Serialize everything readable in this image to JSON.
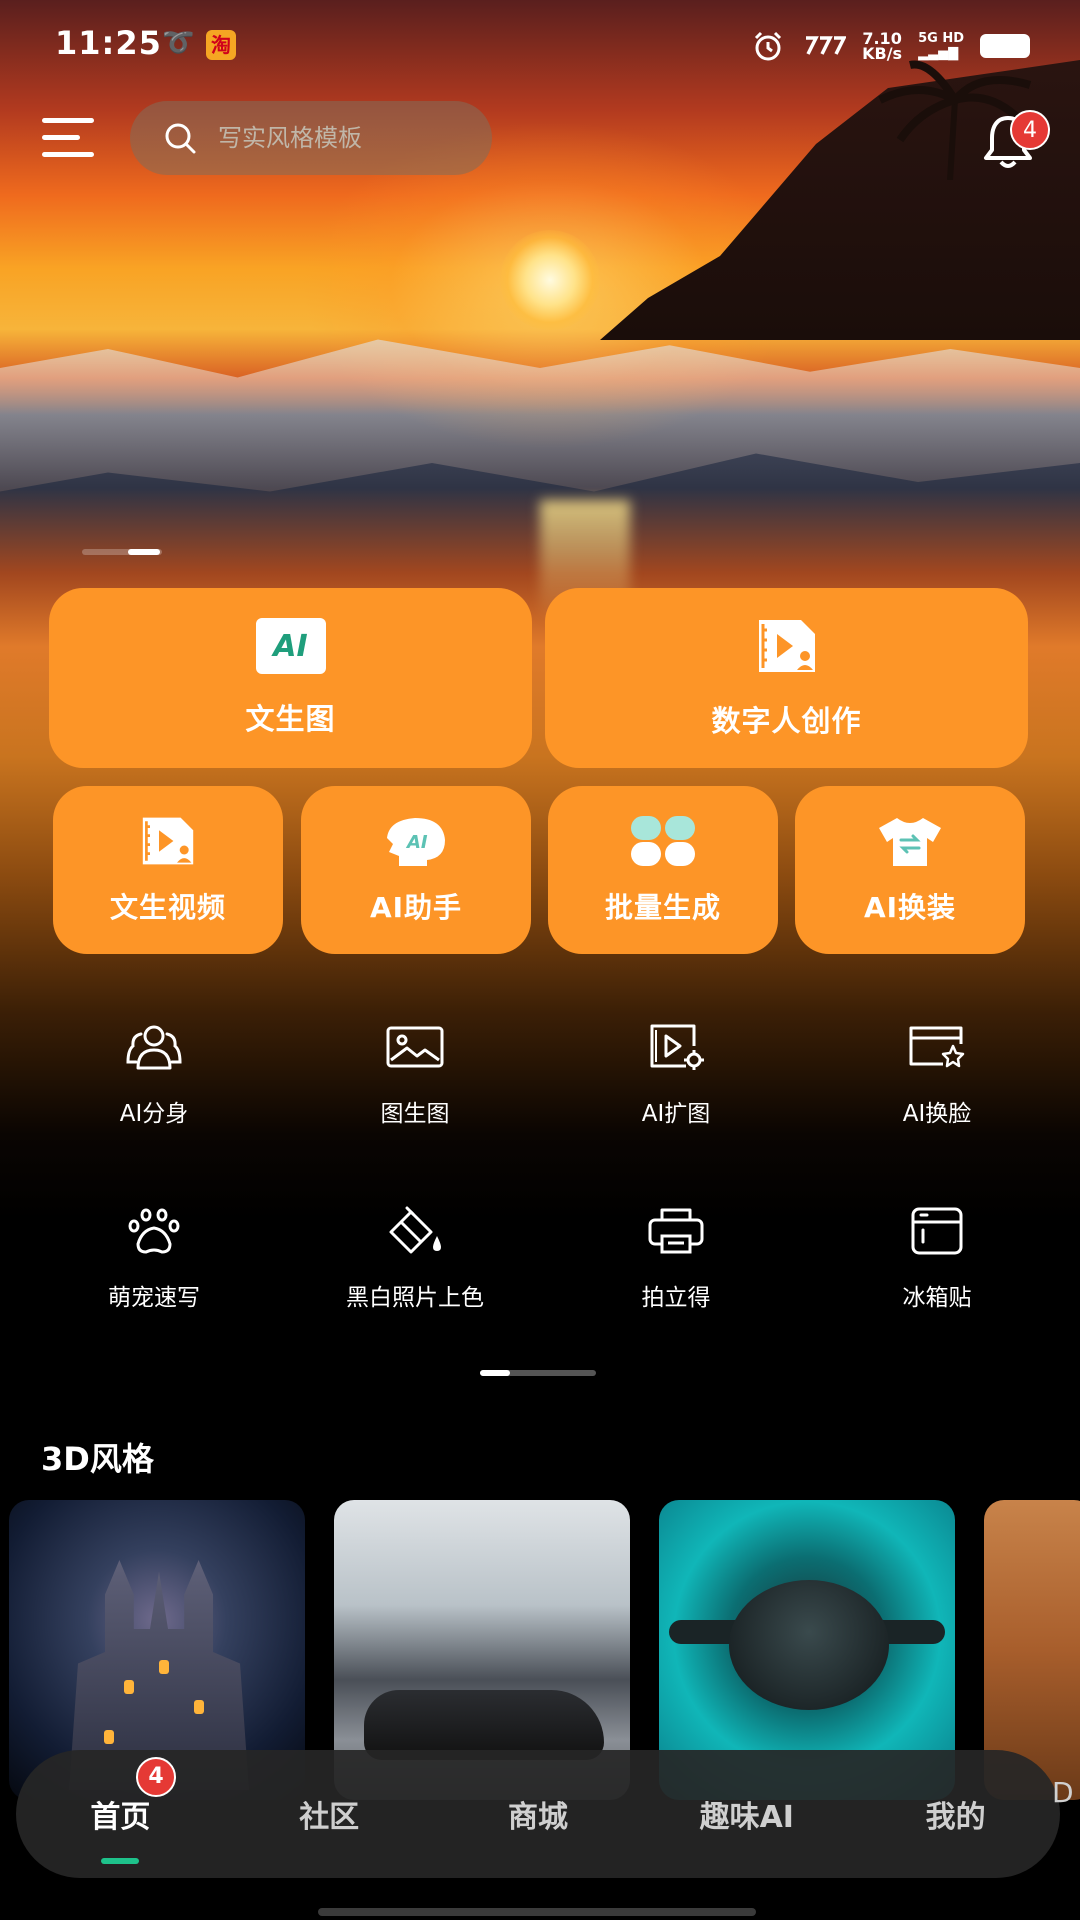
{
  "status_bar": {
    "time": "11:25",
    "net_speed_value": "7.10",
    "net_speed_unit": "KB/s",
    "network": "5G HD"
  },
  "header": {
    "search_placeholder": "写实风格模板",
    "notification_count": "4"
  },
  "big_cards": [
    {
      "label": "文生图",
      "icon": "ai-text-icon"
    },
    {
      "label": "数字人创作",
      "icon": "video-person-icon"
    }
  ],
  "small_cards": [
    {
      "label": "文生视频",
      "icon": "video-person-icon"
    },
    {
      "label": "AI助手",
      "icon": "ai-head-icon"
    },
    {
      "label": "批量生成",
      "icon": "clover-icon"
    },
    {
      "label": "AI换装",
      "icon": "tshirt-icon"
    }
  ],
  "tools": [
    {
      "label": "AI分身",
      "icon": "people-icon"
    },
    {
      "label": "图生图",
      "icon": "image-icon"
    },
    {
      "label": "AI扩图",
      "icon": "video-settings-icon"
    },
    {
      "label": "AI换脸",
      "icon": "card-star-icon"
    },
    {
      "label": "萌宠速写",
      "icon": "paw-icon"
    },
    {
      "label": "黑白照片上色",
      "icon": "paint-bucket-icon"
    },
    {
      "label": "拍立得",
      "icon": "printer-icon"
    },
    {
      "label": "冰箱贴",
      "icon": "fridge-magnet-icon"
    }
  ],
  "section": {
    "title": "3D风格",
    "partial_label": "D"
  },
  "bottom_nav": {
    "items": [
      "首页",
      "社区",
      "商城",
      "趣味AI",
      "我的"
    ],
    "active_index": 0,
    "home_badge": "4"
  },
  "colors": {
    "accent_orange": "#fd9527",
    "active_green": "#1ec28b",
    "badge_red": "#e53935"
  }
}
